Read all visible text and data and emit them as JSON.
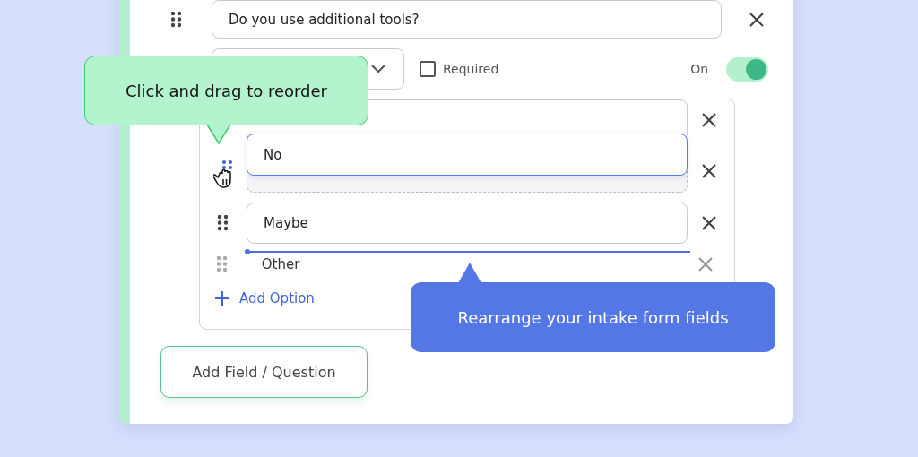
{
  "question": {
    "value": "Do you use additional tools?"
  },
  "settings": {
    "required": {
      "label": "Required",
      "checked": false
    },
    "toggle": {
      "label": "On",
      "on": true
    }
  },
  "options": [
    {
      "kind": "field"
    },
    {
      "kind": "dragging",
      "label": "No"
    },
    {
      "kind": "field",
      "label": "Maybe"
    },
    {
      "kind": "drop-line"
    },
    {
      "kind": "plain",
      "label": "Other"
    }
  ],
  "add_option": "Add Option",
  "add_field": "Add Field / Question",
  "tooltips": [
    {
      "kind": "green",
      "text": "Click and drag to reorder"
    },
    {
      "kind": "blue",
      "text": "Rearrange your intake form fields"
    }
  ]
}
